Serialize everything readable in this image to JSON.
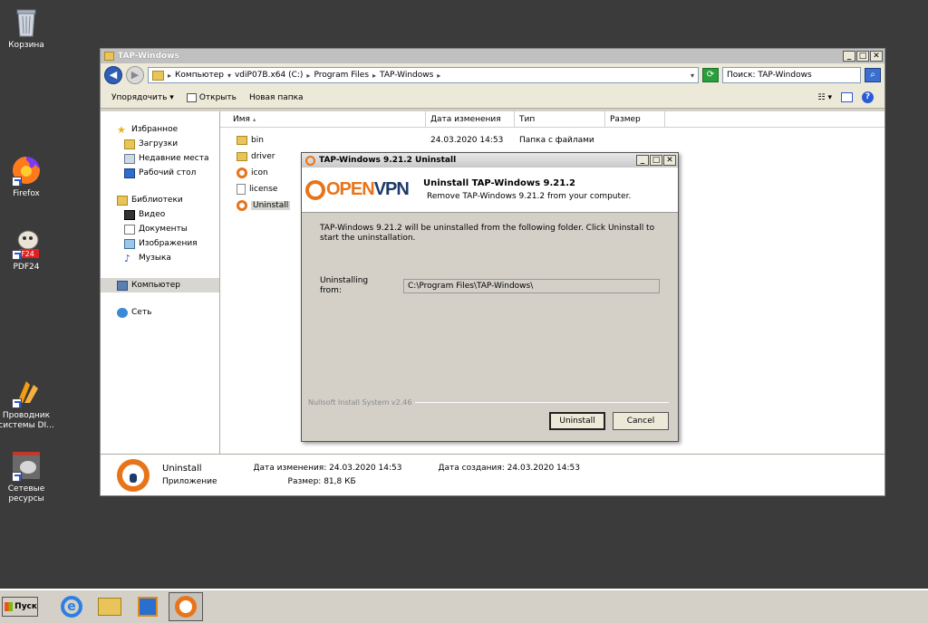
{
  "desktop": {
    "icons": [
      {
        "label": "Корзина",
        "icon": "recycle-bin-icon"
      },
      {
        "label": "Firefox",
        "icon": "firefox-icon"
      },
      {
        "label": "PDF24",
        "icon": "pdf24-icon"
      },
      {
        "label": "Проводник системы DI...",
        "icon": "explorer-shortcut-icon"
      },
      {
        "label": "Сетевые ресурсы",
        "icon": "network-resources-icon"
      }
    ]
  },
  "explorer": {
    "title": "TAP-Windows",
    "address": {
      "crumbs": [
        "Компьютер",
        "vdiP07B.x64 (C:)",
        "Program Files",
        "TAP-Windows"
      ]
    },
    "search_placeholder": "Поиск: TAP-Windows",
    "toolbar": {
      "organize": "Упорядочить ▾",
      "open": "Открыть",
      "new_folder": "Новая папка"
    },
    "nav": {
      "favorites": "Избранное",
      "downloads": "Загрузки",
      "recent": "Недавние места",
      "desktop": "Рабочий стол",
      "libraries": "Библиотеки",
      "video": "Видео",
      "documents": "Документы",
      "images": "Изображения",
      "music": "Музыка",
      "computer": "Компьютер",
      "network": "Сеть"
    },
    "columns": {
      "name": "Имя",
      "modified": "Дата изменения",
      "type": "Тип",
      "size": "Размер"
    },
    "files": [
      {
        "name": "bin",
        "modified": "24.03.2020 14:53",
        "type": "Папка с файлами",
        "icon": "folder-icon"
      },
      {
        "name": "driver",
        "modified": "",
        "type": "",
        "icon": "folder-icon"
      },
      {
        "name": "icon",
        "modified": "",
        "type": "",
        "icon": "openvpn-icon"
      },
      {
        "name": "license",
        "modified": "",
        "type": "",
        "icon": "document-icon"
      },
      {
        "name": "Uninstall",
        "modified": "",
        "type": "",
        "icon": "openvpn-icon"
      }
    ],
    "details": {
      "name": "Uninstall",
      "kind": "Приложение",
      "modified_label": "Дата изменения:",
      "modified_value": "24.03.2020 14:53",
      "size_label": "Размер:",
      "size_value": "81,8 КБ",
      "created_label": "Дата создания:",
      "created_value": "24.03.2020 14:53"
    }
  },
  "dialog": {
    "title": "TAP-Windows 9.21.2 Uninstall",
    "logo_open": "OPEN",
    "logo_vpn": "VPN",
    "heading": "Uninstall TAP-Windows 9.21.2",
    "subheading": "Remove TAP-Windows 9.21.2 from your computer.",
    "body_text": "TAP-Windows 9.21.2 will be uninstalled from the following folder. Click Uninstall to start the uninstallation.",
    "from_label": "Uninstalling from:",
    "from_value": "C:\\Program Files\\TAP-Windows\\",
    "nsis": "Nullsoft Install System v2.46",
    "uninstall_btn": "Uninstall",
    "cancel_btn": "Cancel"
  },
  "taskbar": {
    "start": "Пуск"
  }
}
